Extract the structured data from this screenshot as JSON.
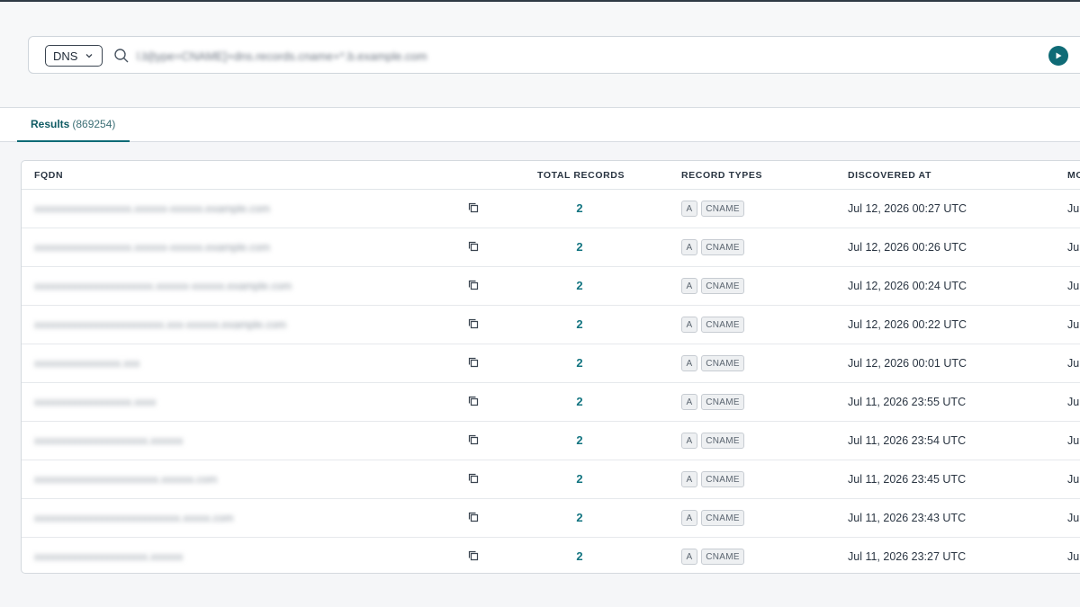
{
  "search": {
    "type_selected": "DNS",
    "query": "l.b[type=CNAME]+dns.records.cname+*.b.example.com"
  },
  "tabs": [
    {
      "label": "Results",
      "count": "(869254)"
    }
  ],
  "table": {
    "columns": [
      "FQDN",
      "TOTAL RECORDS",
      "RECORD TYPES",
      "DISCOVERED AT",
      "MO"
    ],
    "rows": [
      {
        "fqdn": "xxxxxxxxxxxxxxxxxx.xxxxxx-xxxxxx.example.com",
        "total": "2",
        "types": [
          "A",
          "CNAME"
        ],
        "discovered": "Jul 12, 2026 00:27 UTC",
        "modified": "Ju"
      },
      {
        "fqdn": "xxxxxxxxxxxxxxxxxx.xxxxxx-xxxxxx.example.com",
        "total": "2",
        "types": [
          "A",
          "CNAME"
        ],
        "discovered": "Jul 12, 2026 00:26 UTC",
        "modified": "Ju"
      },
      {
        "fqdn": "xxxxxxxxxxxxxxxxxxxxxx.xxxxxx-xxxxxx.example.com",
        "total": "2",
        "types": [
          "A",
          "CNAME"
        ],
        "discovered": "Jul 12, 2026 00:24 UTC",
        "modified": "Ju"
      },
      {
        "fqdn": "xxxxxxxxxxxxxxxxxxxxxxxx.xxx-xxxxxx.example.com",
        "total": "2",
        "types": [
          "A",
          "CNAME"
        ],
        "discovered": "Jul 12, 2026 00:22 UTC",
        "modified": "Ju"
      },
      {
        "fqdn": "xxxxxxxxxxxxxxxx.xxx",
        "total": "2",
        "types": [
          "A",
          "CNAME"
        ],
        "discovered": "Jul 12, 2026 00:01 UTC",
        "modified": "Ju"
      },
      {
        "fqdn": "xxxxxxxxxxxxxxxxxx.xxxx",
        "total": "2",
        "types": [
          "A",
          "CNAME"
        ],
        "discovered": "Jul 11, 2026 23:55 UTC",
        "modified": "Ju"
      },
      {
        "fqdn": "xxxxxxxxxxxxxxxxxxxxx.xxxxxx",
        "total": "2",
        "types": [
          "A",
          "CNAME"
        ],
        "discovered": "Jul 11, 2026 23:54 UTC",
        "modified": "Ju"
      },
      {
        "fqdn": "xxxxxxxxxxxxxxxxxxxxxxx.xxxxxx.com",
        "total": "2",
        "types": [
          "A",
          "CNAME"
        ],
        "discovered": "Jul 11, 2026 23:45 UTC",
        "modified": "Ju"
      },
      {
        "fqdn": "xxxxxxxxxxxxxxxxxxxxxxxxxxx.xxxxx.com",
        "total": "2",
        "types": [
          "A",
          "CNAME"
        ],
        "discovered": "Jul 11, 2026 23:43 UTC",
        "modified": "Ju"
      },
      {
        "fqdn": "xxxxxxxxxxxxxxxxxxxxx.xxxxxx",
        "total": "2",
        "types": [
          "A",
          "CNAME"
        ],
        "discovered": "Jul 11, 2026 23:27 UTC",
        "modified": "Ju"
      }
    ]
  },
  "icons": {
    "dropdown": "chevron-down-icon",
    "search": "search-icon",
    "submit": "play-circle-icon",
    "copy": "copy-icon"
  },
  "colors": {
    "accent": "#0f6b76",
    "link": "#127480"
  }
}
